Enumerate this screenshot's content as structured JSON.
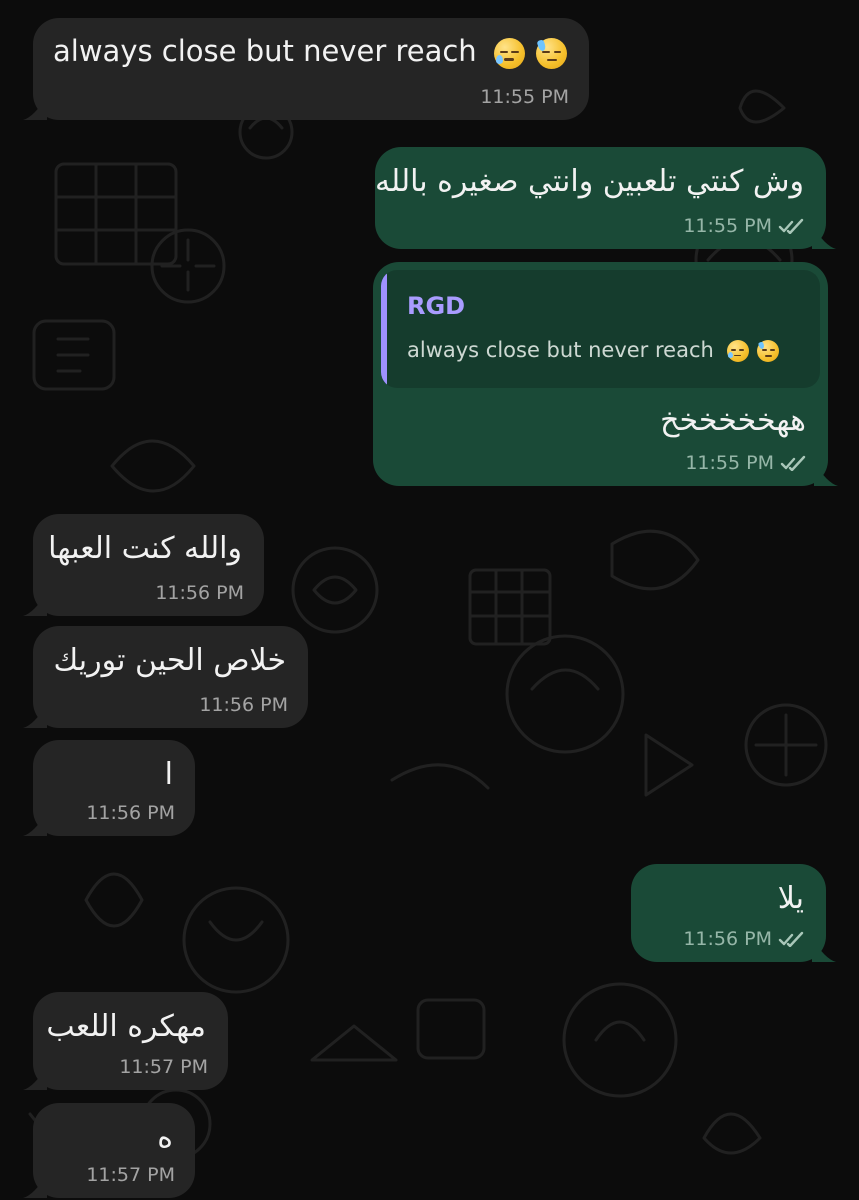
{
  "messages": [
    {
      "text": "always close but never reach",
      "time": "11:55 PM",
      "emoji_names": [
        "sleepy-face-icon",
        "downcast-sweat-face-icon"
      ]
    },
    {
      "text": "وش كنتي تلعبين وانتي صغيره بالله",
      "time": "11:55 PM"
    },
    {
      "reply_author": "RGD",
      "reply_text": "always close but never reach",
      "text": "ههخخخخخخ",
      "time": "11:55 PM",
      "emoji_names": [
        "sleepy-face-icon",
        "downcast-sweat-face-icon"
      ]
    },
    {
      "text": "والله كنت العبها",
      "time": "11:56 PM"
    },
    {
      "text": "خلاص الحين توريك",
      "time": "11:56 PM"
    },
    {
      "text": "ا",
      "time": "11:56 PM"
    },
    {
      "text": "يلا",
      "time": "11:56 PM"
    },
    {
      "text": "مهكره اللعب",
      "time": "11:57 PM"
    },
    {
      "text": "ه",
      "time": "11:57 PM"
    }
  ],
  "colors": {
    "incoming_bubble": "#252525",
    "outgoing_bubble": "#1a4a37",
    "reply_accent": "#9f91ff"
  },
  "icons": {
    "read_receipt": "double-check-icon"
  }
}
